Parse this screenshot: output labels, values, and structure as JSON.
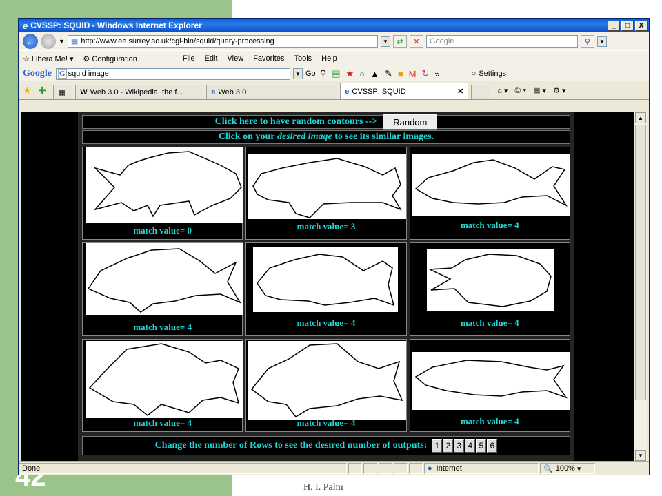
{
  "slide": {
    "number": "42",
    "footer": "H. I. Palm"
  },
  "window": {
    "title": "CVSSP: SQUID - Windows Internet Explorer",
    "controls": {
      "minimize": "_",
      "maximize": "□",
      "close": "X"
    }
  },
  "address": {
    "url": "http://www.ee.surrey.ac.uk/cgi-bin/squid/query-processing",
    "search_placeholder": "Google"
  },
  "links": {
    "libera": "Libera Me!",
    "config": "Configuration"
  },
  "menu": [
    "File",
    "Edit",
    "View",
    "Favorites",
    "Tools",
    "Help"
  ],
  "google_bar": {
    "logo": "Google",
    "query": "squid image",
    "go": "Go",
    "settings": "Settings"
  },
  "tabs": [
    {
      "label": "Web 3.0 - Wikipedia, the f...",
      "icon": "W"
    },
    {
      "label": "Web 3.0",
      "icon": "e"
    },
    {
      "label": "CVSSP: SQUID",
      "icon": "e",
      "active": true
    }
  ],
  "page": {
    "random_text": "Click here to have random contours -->",
    "random_button": "Random",
    "instruction_pre": "Click on your ",
    "instruction_em": "desired image",
    "instruction_post": " to see its similar images.",
    "results": [
      {
        "match": "match value= 0"
      },
      {
        "match": "match value= 3"
      },
      {
        "match": "match value= 4"
      },
      {
        "match": "match value= 4"
      },
      {
        "match": "match value= 4"
      },
      {
        "match": "match value= 4"
      },
      {
        "match": "match value= 4"
      },
      {
        "match": "match value= 4"
      },
      {
        "match": "match value= 4"
      }
    ],
    "rows_text": "Change the number of Rows to see the desired number of outputs:",
    "row_buttons": [
      "1",
      "2",
      "3",
      "4",
      "5",
      "6"
    ]
  },
  "status": {
    "text": "Done",
    "zone": "Internet",
    "zoom": "100%"
  }
}
